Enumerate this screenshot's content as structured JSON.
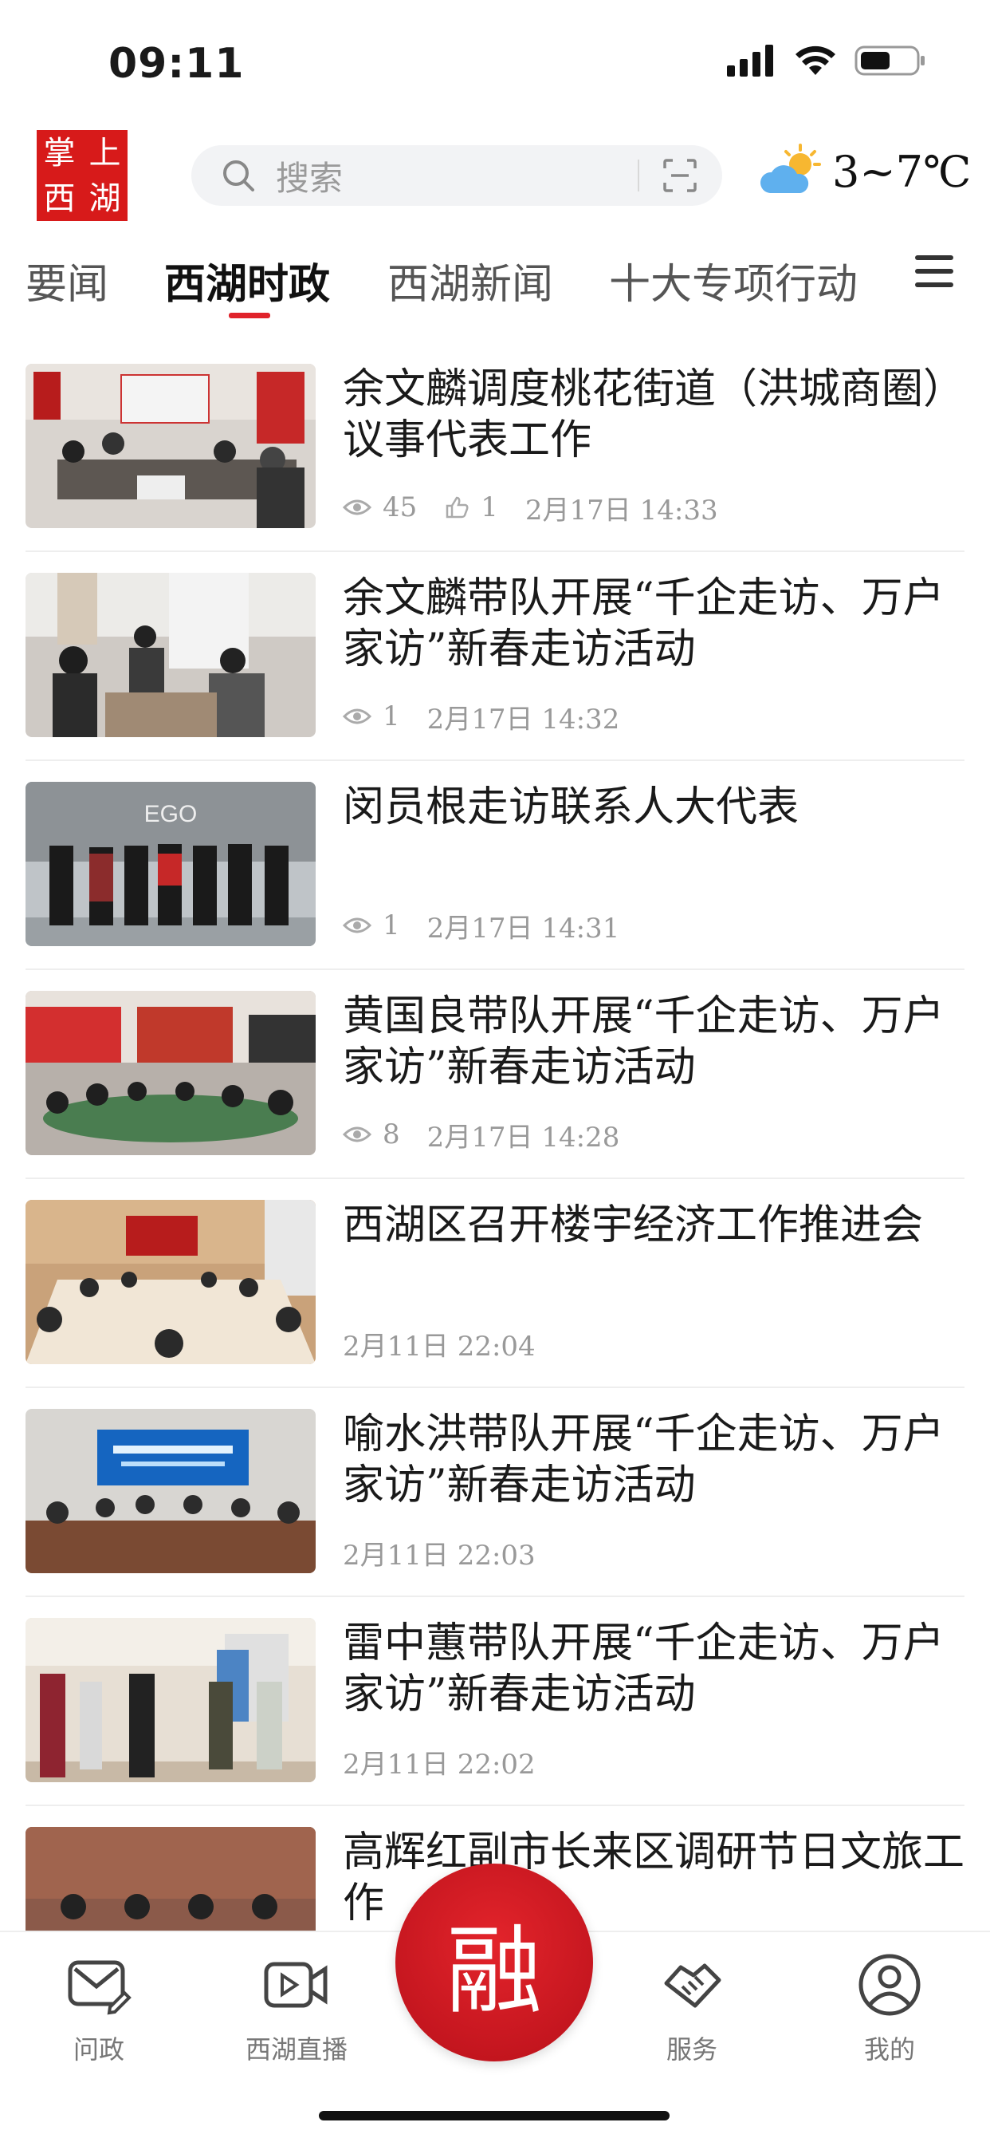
{
  "status_bar": {
    "time": "09:11"
  },
  "header": {
    "logo_chars": [
      "掌",
      "上",
      "西",
      "湖"
    ],
    "search_placeholder": "搜索",
    "weather_temp": "3~7℃"
  },
  "tabs": [
    {
      "label": "要闻",
      "active": false
    },
    {
      "label": "西湖时政",
      "active": true
    },
    {
      "label": "西湖新闻",
      "active": false
    },
    {
      "label": "十大专项行动",
      "active": false
    }
  ],
  "news": [
    {
      "title": "余文麟调度桃花街道（洪城商圈）议事代表工作",
      "views": "45",
      "likes": "1",
      "time": "2月17日  14:33"
    },
    {
      "title": "余文麟带队开展“千企走访、万户家访”新春走访活动",
      "views": "1",
      "time": "2月17日  14:32"
    },
    {
      "title": "闵员根走访联系人大代表",
      "views": "1",
      "time": "2月17日  14:31"
    },
    {
      "title": "黄国良带队开展“千企走访、万户家访”新春走访活动",
      "views": "8",
      "time": "2月17日  14:28"
    },
    {
      "title": "西湖区召开楼宇经济工作推进会",
      "time": "2月11日  22:04"
    },
    {
      "title": "喻水洪带队开展“千企走访、万户家访”新春走访活动",
      "time": "2月11日  22:03"
    },
    {
      "title": "雷中蕙带队开展“千企走访、万户家访”新春走访活动",
      "time": "2月11日  22:02"
    },
    {
      "title": "高辉红副市长来区调研节日文旅工作",
      "time": ""
    }
  ],
  "bottom_nav": [
    {
      "label": "问政",
      "icon": "envelope-pen-icon"
    },
    {
      "label": "西湖直播",
      "icon": "video-play-icon"
    },
    {
      "label": "融",
      "icon": "rong-logo"
    },
    {
      "label": "服务",
      "icon": "handshake-icon"
    },
    {
      "label": "我的",
      "icon": "user-icon"
    }
  ],
  "colors": {
    "accent": "#e0232b",
    "logo_bg": "#d71a1a"
  }
}
